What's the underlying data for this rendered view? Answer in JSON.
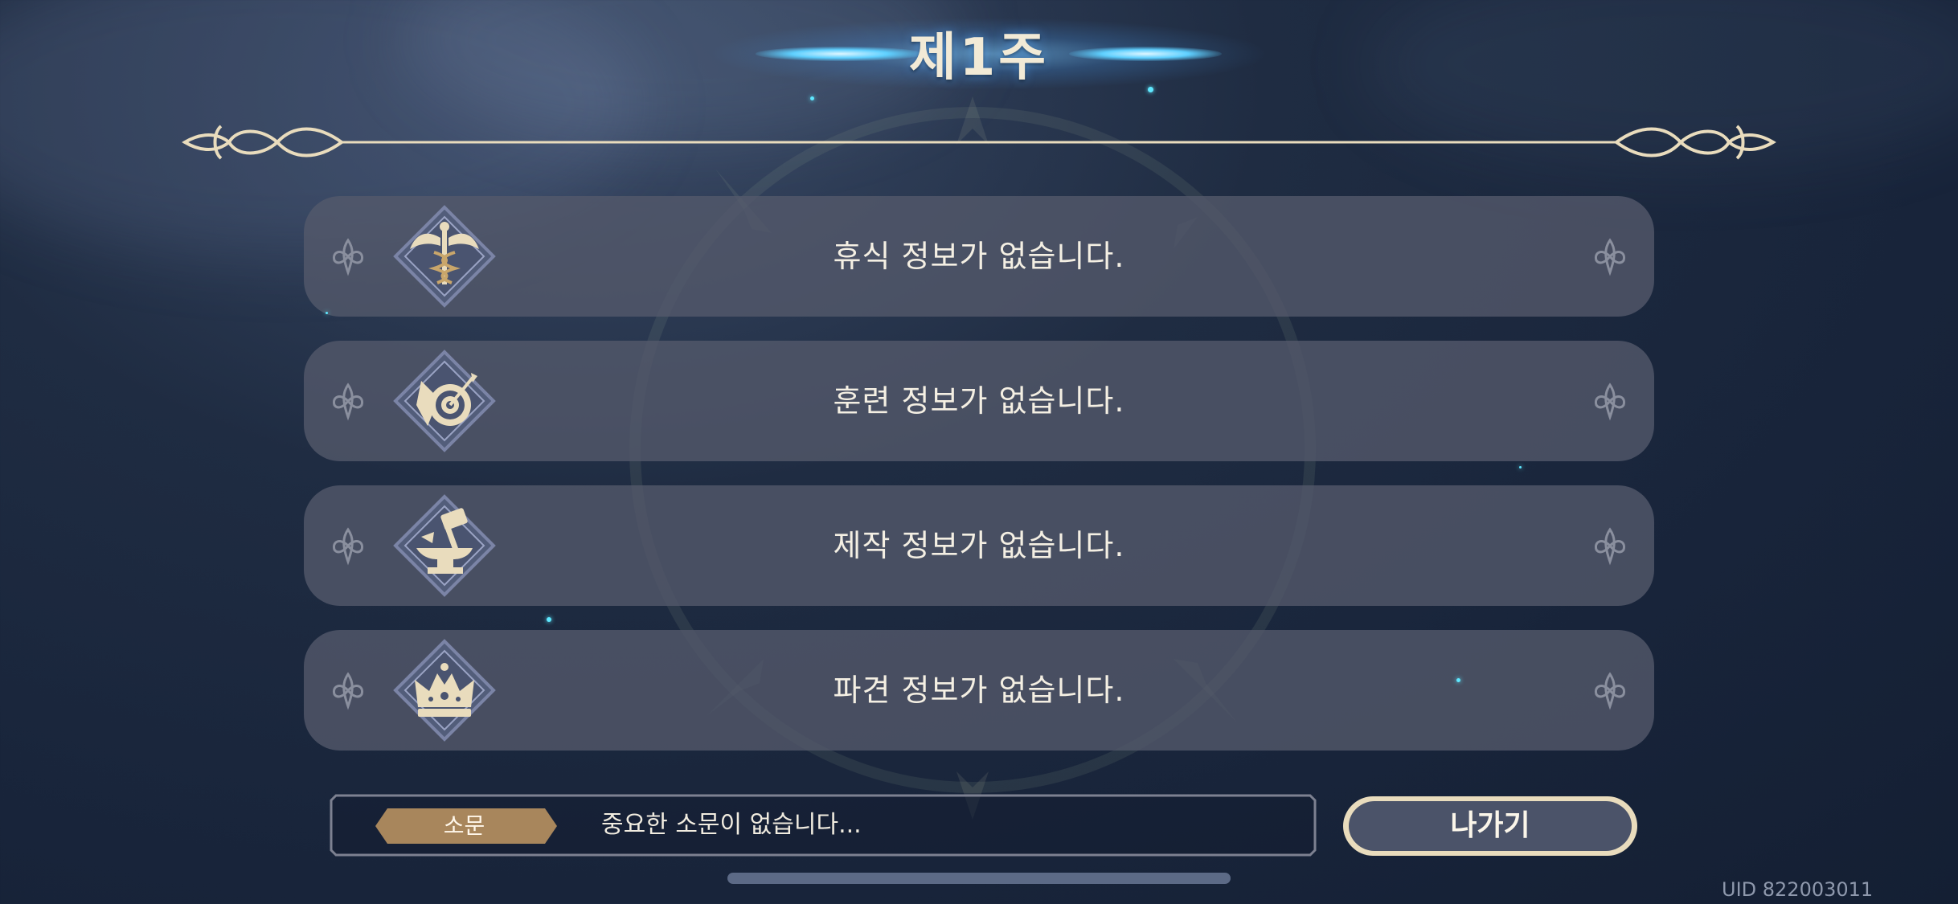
{
  "title": "제1주",
  "rows": [
    {
      "icon": "caduceus-icon",
      "text": "휴식 정보가 없습니다."
    },
    {
      "icon": "archery-target-icon",
      "text": "훈련 정보가 없습니다."
    },
    {
      "icon": "anvil-hammer-icon",
      "text": "제작 정보가 없습니다."
    },
    {
      "icon": "crown-icon",
      "text": "파견 정보가 없습니다."
    }
  ],
  "rumor": {
    "tag": "소문",
    "message": "중요한 소문이 없습니다..."
  },
  "exit_label": "나가기",
  "uid": "UID 822003011",
  "colors": {
    "gold": "#e9dcbd",
    "panel": "#454b5c",
    "tag": "#a8865c",
    "button": "#4b5369"
  }
}
